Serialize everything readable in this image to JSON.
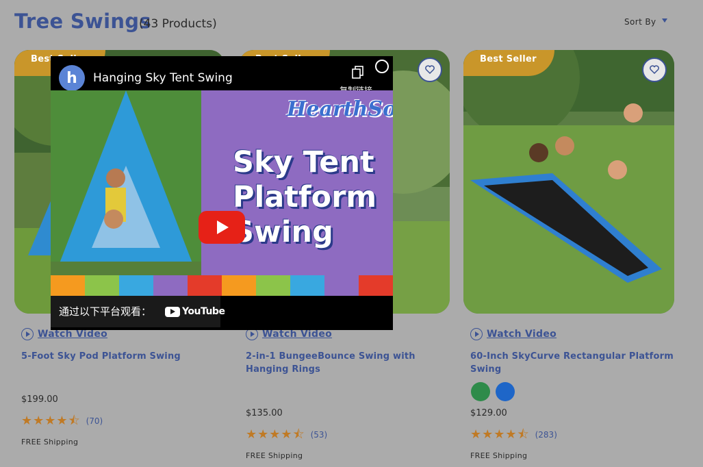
{
  "header": {
    "title": "Tree Swings",
    "count": "(43 Products)",
    "sort_label": "Sort By"
  },
  "products": [
    {
      "badge": "Best Seller",
      "watch_label": "Watch Video",
      "name": "5-Foot Sky Pod Platform Swing",
      "price": "$199.00",
      "rating": 4.5,
      "reviews": "(70)",
      "shipping": "FREE Shipping"
    },
    {
      "badge": "Best Seller",
      "watch_label": "Watch Video",
      "name": "2-in-1 BungeeBounce Swing with Hanging Rings",
      "price": "$135.00",
      "rating": 4.5,
      "reviews": "(53)",
      "shipping": "FREE Shipping"
    },
    {
      "badge": "Best Seller",
      "watch_label": "Watch Video",
      "name": "60-Inch SkyCurve Rectangular Platform Swing",
      "price": "$129.00",
      "rating": 4.5,
      "reviews": "(283)",
      "shipping": "FREE Shipping",
      "swatches": [
        "#2e8b4a",
        "#1e66c8"
      ]
    }
  ],
  "video": {
    "channel_initial": "h",
    "title": "Hanging Sky Tent Swing",
    "copy_label": "复制链接",
    "brand": "HearthSong",
    "thumb_title_1": "Sky Tent",
    "thumb_title_2": "Platform",
    "thumb_title_3": "Swing",
    "watch_on": "通过以下平台观看：",
    "yt_word": "YouTube"
  },
  "colors": {
    "accent": "#3c5394",
    "badge": "#c9962a",
    "star": "#c07a25",
    "youtube_red": "#e62117"
  }
}
